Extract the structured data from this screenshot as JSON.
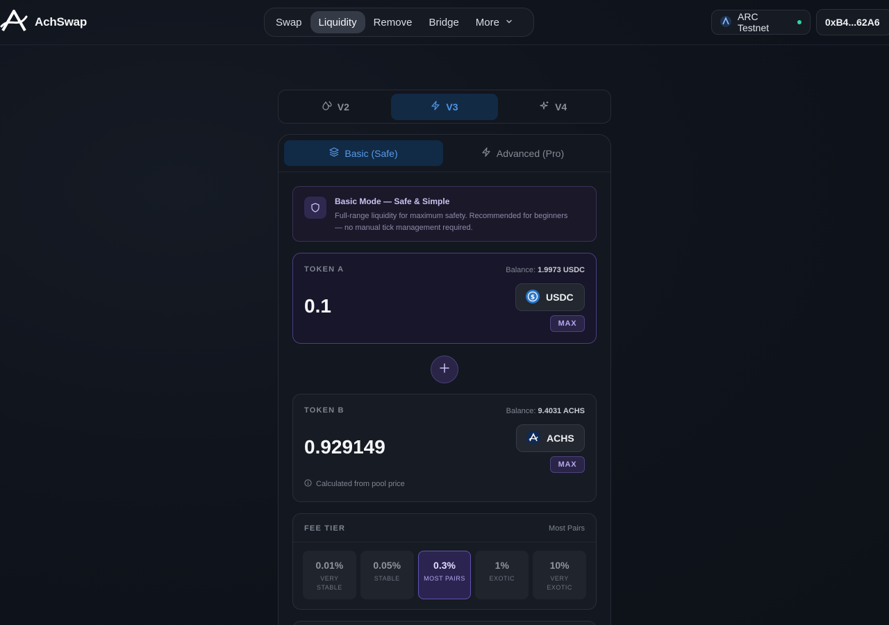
{
  "brand": {
    "name": "AchSwap",
    "logo_icon": "achswap-logo-icon"
  },
  "nav": {
    "items": [
      {
        "label": "Swap",
        "active": false
      },
      {
        "label": "Liquidity",
        "active": true
      },
      {
        "label": "Remove",
        "active": false
      },
      {
        "label": "Bridge",
        "active": false
      },
      {
        "label": "More",
        "active": false,
        "icon": "chevron-down-icon"
      }
    ]
  },
  "network": {
    "label": "ARC Testnet",
    "status_color": "#2fd6a1"
  },
  "wallet": {
    "address": "0xB4...62A6"
  },
  "version_tabs": [
    {
      "label": "V2",
      "icon": "droplets-icon",
      "active": false
    },
    {
      "label": "V3",
      "icon": "zap-icon",
      "active": true
    },
    {
      "label": "V4",
      "icon": "sparkles-icon",
      "active": false
    }
  ],
  "mode_tabs": [
    {
      "label": "Basic (Safe)",
      "icon": "layers-icon",
      "active": true
    },
    {
      "label": "Advanced (Pro)",
      "icon": "zap-icon",
      "active": false
    }
  ],
  "info": {
    "icon": "shield-icon",
    "title": "Basic Mode — Safe & Simple",
    "text": "Full-range liquidity for maximum safety. Recommended for beginners — no manual tick management required."
  },
  "token_a": {
    "label": "TOKEN A",
    "balance_prefix": "Balance:",
    "balance": "1.9973 USDC",
    "amount": "0.1",
    "symbol": "USDC",
    "icon": "usdc-icon",
    "max_label": "MAX"
  },
  "plus_icon": "plus-icon",
  "token_b": {
    "label": "TOKEN B",
    "balance_prefix": "Balance:",
    "balance": "9.4031 ACHS",
    "amount": "0.929149",
    "symbol": "ACHS",
    "icon": "achs-icon",
    "max_label": "MAX",
    "note": "Calculated from pool price",
    "note_icon": "info-icon"
  },
  "fee": {
    "title": "FEE TIER",
    "selected_label": "Most Pairs",
    "options": [
      {
        "pct": "0.01%",
        "desc": "Very Stable",
        "active": false
      },
      {
        "pct": "0.05%",
        "desc": "Stable",
        "active": false
      },
      {
        "pct": "0.3%",
        "desc": "Most Pairs",
        "active": true
      },
      {
        "pct": "1%",
        "desc": "Exotic",
        "active": false
      },
      {
        "pct": "10%",
        "desc": "Very Exotic",
        "active": false
      }
    ]
  },
  "colors": {
    "accent_blue": "#4e95e6",
    "accent_purple": "#6052b2"
  }
}
